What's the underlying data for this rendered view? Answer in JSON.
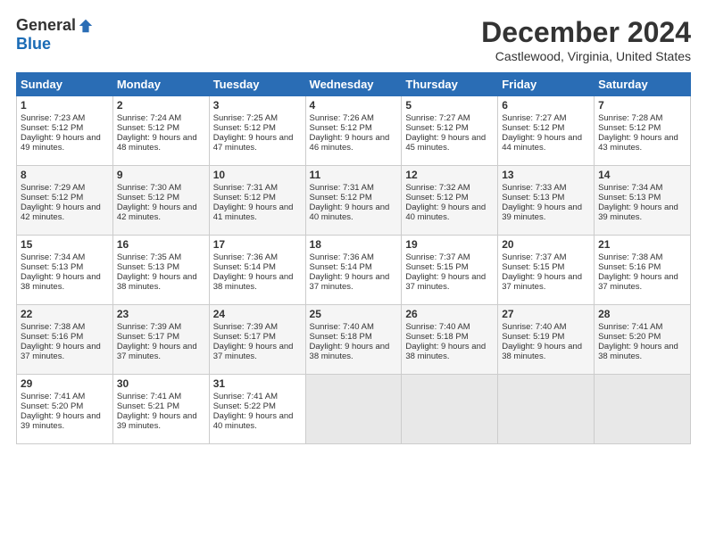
{
  "header": {
    "logo_general": "General",
    "logo_blue": "Blue",
    "title": "December 2024",
    "location": "Castlewood, Virginia, United States"
  },
  "days_of_week": [
    "Sunday",
    "Monday",
    "Tuesday",
    "Wednesday",
    "Thursday",
    "Friday",
    "Saturday"
  ],
  "weeks": [
    [
      {
        "day": "1",
        "sunrise": "Sunrise: 7:23 AM",
        "sunset": "Sunset: 5:12 PM",
        "daylight": "Daylight: 9 hours and 49 minutes."
      },
      {
        "day": "2",
        "sunrise": "Sunrise: 7:24 AM",
        "sunset": "Sunset: 5:12 PM",
        "daylight": "Daylight: 9 hours and 48 minutes."
      },
      {
        "day": "3",
        "sunrise": "Sunrise: 7:25 AM",
        "sunset": "Sunset: 5:12 PM",
        "daylight": "Daylight: 9 hours and 47 minutes."
      },
      {
        "day": "4",
        "sunrise": "Sunrise: 7:26 AM",
        "sunset": "Sunset: 5:12 PM",
        "daylight": "Daylight: 9 hours and 46 minutes."
      },
      {
        "day": "5",
        "sunrise": "Sunrise: 7:27 AM",
        "sunset": "Sunset: 5:12 PM",
        "daylight": "Daylight: 9 hours and 45 minutes."
      },
      {
        "day": "6",
        "sunrise": "Sunrise: 7:27 AM",
        "sunset": "Sunset: 5:12 PM",
        "daylight": "Daylight: 9 hours and 44 minutes."
      },
      {
        "day": "7",
        "sunrise": "Sunrise: 7:28 AM",
        "sunset": "Sunset: 5:12 PM",
        "daylight": "Daylight: 9 hours and 43 minutes."
      }
    ],
    [
      {
        "day": "8",
        "sunrise": "Sunrise: 7:29 AM",
        "sunset": "Sunset: 5:12 PM",
        "daylight": "Daylight: 9 hours and 42 minutes."
      },
      {
        "day": "9",
        "sunrise": "Sunrise: 7:30 AM",
        "sunset": "Sunset: 5:12 PM",
        "daylight": "Daylight: 9 hours and 42 minutes."
      },
      {
        "day": "10",
        "sunrise": "Sunrise: 7:31 AM",
        "sunset": "Sunset: 5:12 PM",
        "daylight": "Daylight: 9 hours and 41 minutes."
      },
      {
        "day": "11",
        "sunrise": "Sunrise: 7:31 AM",
        "sunset": "Sunset: 5:12 PM",
        "daylight": "Daylight: 9 hours and 40 minutes."
      },
      {
        "day": "12",
        "sunrise": "Sunrise: 7:32 AM",
        "sunset": "Sunset: 5:12 PM",
        "daylight": "Daylight: 9 hours and 40 minutes."
      },
      {
        "day": "13",
        "sunrise": "Sunrise: 7:33 AM",
        "sunset": "Sunset: 5:13 PM",
        "daylight": "Daylight: 9 hours and 39 minutes."
      },
      {
        "day": "14",
        "sunrise": "Sunrise: 7:34 AM",
        "sunset": "Sunset: 5:13 PM",
        "daylight": "Daylight: 9 hours and 39 minutes."
      }
    ],
    [
      {
        "day": "15",
        "sunrise": "Sunrise: 7:34 AM",
        "sunset": "Sunset: 5:13 PM",
        "daylight": "Daylight: 9 hours and 38 minutes."
      },
      {
        "day": "16",
        "sunrise": "Sunrise: 7:35 AM",
        "sunset": "Sunset: 5:13 PM",
        "daylight": "Daylight: 9 hours and 38 minutes."
      },
      {
        "day": "17",
        "sunrise": "Sunrise: 7:36 AM",
        "sunset": "Sunset: 5:14 PM",
        "daylight": "Daylight: 9 hours and 38 minutes."
      },
      {
        "day": "18",
        "sunrise": "Sunrise: 7:36 AM",
        "sunset": "Sunset: 5:14 PM",
        "daylight": "Daylight: 9 hours and 37 minutes."
      },
      {
        "day": "19",
        "sunrise": "Sunrise: 7:37 AM",
        "sunset": "Sunset: 5:15 PM",
        "daylight": "Daylight: 9 hours and 37 minutes."
      },
      {
        "day": "20",
        "sunrise": "Sunrise: 7:37 AM",
        "sunset": "Sunset: 5:15 PM",
        "daylight": "Daylight: 9 hours and 37 minutes."
      },
      {
        "day": "21",
        "sunrise": "Sunrise: 7:38 AM",
        "sunset": "Sunset: 5:16 PM",
        "daylight": "Daylight: 9 hours and 37 minutes."
      }
    ],
    [
      {
        "day": "22",
        "sunrise": "Sunrise: 7:38 AM",
        "sunset": "Sunset: 5:16 PM",
        "daylight": "Daylight: 9 hours and 37 minutes."
      },
      {
        "day": "23",
        "sunrise": "Sunrise: 7:39 AM",
        "sunset": "Sunset: 5:17 PM",
        "daylight": "Daylight: 9 hours and 37 minutes."
      },
      {
        "day": "24",
        "sunrise": "Sunrise: 7:39 AM",
        "sunset": "Sunset: 5:17 PM",
        "daylight": "Daylight: 9 hours and 37 minutes."
      },
      {
        "day": "25",
        "sunrise": "Sunrise: 7:40 AM",
        "sunset": "Sunset: 5:18 PM",
        "daylight": "Daylight: 9 hours and 38 minutes."
      },
      {
        "day": "26",
        "sunrise": "Sunrise: 7:40 AM",
        "sunset": "Sunset: 5:18 PM",
        "daylight": "Daylight: 9 hours and 38 minutes."
      },
      {
        "day": "27",
        "sunrise": "Sunrise: 7:40 AM",
        "sunset": "Sunset: 5:19 PM",
        "daylight": "Daylight: 9 hours and 38 minutes."
      },
      {
        "day": "28",
        "sunrise": "Sunrise: 7:41 AM",
        "sunset": "Sunset: 5:20 PM",
        "daylight": "Daylight: 9 hours and 38 minutes."
      }
    ],
    [
      {
        "day": "29",
        "sunrise": "Sunrise: 7:41 AM",
        "sunset": "Sunset: 5:20 PM",
        "daylight": "Daylight: 9 hours and 39 minutes."
      },
      {
        "day": "30",
        "sunrise": "Sunrise: 7:41 AM",
        "sunset": "Sunset: 5:21 PM",
        "daylight": "Daylight: 9 hours and 39 minutes."
      },
      {
        "day": "31",
        "sunrise": "Sunrise: 7:41 AM",
        "sunset": "Sunset: 5:22 PM",
        "daylight": "Daylight: 9 hours and 40 minutes."
      },
      null,
      null,
      null,
      null
    ]
  ]
}
